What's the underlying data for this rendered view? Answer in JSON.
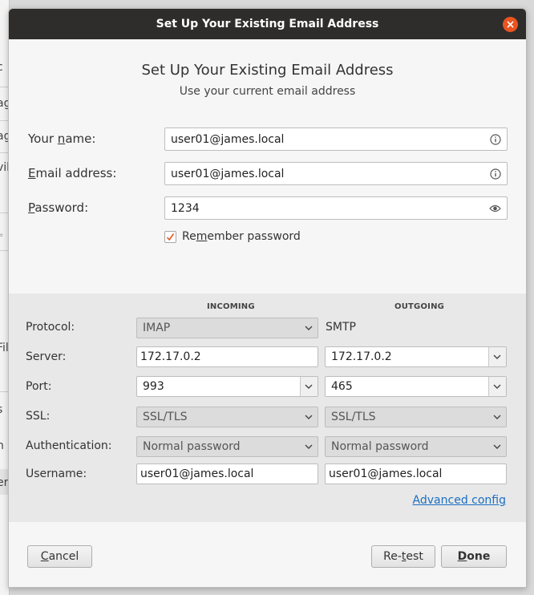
{
  "background_app": {
    "fragments": [
      "c",
      "ag",
      "ag",
      "vil",
      "=",
      "Fil",
      "s",
      "n",
      "er"
    ]
  },
  "window": {
    "title": "Set Up Your Existing Email Address",
    "close_icon": "close-icon"
  },
  "header": {
    "title": "Set Up Your Existing Email Address",
    "subtitle": "Use your current email address"
  },
  "form": {
    "name": {
      "label_pre": "Your ",
      "label_key": "n",
      "label_post": "ame:",
      "value": "user01@james.local",
      "icon": "info-icon"
    },
    "email": {
      "label_pre": "",
      "label_key": "E",
      "label_post": "mail address:",
      "value": "user01@james.local",
      "icon": "info-icon"
    },
    "password": {
      "label_pre": "",
      "label_key": "P",
      "label_post": "assword:",
      "value": "1234",
      "icon": "eye-icon"
    },
    "remember": {
      "label_pre": "Re",
      "label_key": "m",
      "label_post": "ember password",
      "checked": true
    }
  },
  "config": {
    "incoming_header": "INCOMING",
    "outgoing_header": "OUTGOING",
    "labels": {
      "protocol": "Protocol:",
      "server": "Server:",
      "port": "Port:",
      "ssl": "SSL:",
      "authentication": "Authentication:",
      "username": "Username:"
    },
    "incoming": {
      "protocol": "IMAP",
      "server": "172.17.0.2",
      "port": "993",
      "ssl": "SSL/TLS",
      "authentication": "Normal password",
      "username": "user01@james.local"
    },
    "outgoing": {
      "protocol": "SMTP",
      "server": "172.17.0.2",
      "port": "465",
      "ssl": "SSL/TLS",
      "authentication": "Normal password",
      "username": "user01@james.local"
    },
    "advanced_link": "Advanced config"
  },
  "buttons": {
    "cancel": {
      "pre": "",
      "key": "C",
      "post": "ancel"
    },
    "retest": {
      "pre": "Re-",
      "key": "t",
      "post": "est"
    },
    "done": {
      "pre": "",
      "key": "D",
      "post": "one"
    }
  },
  "colors": {
    "accent": "#e95420",
    "link": "#1a6fc2",
    "titlebar": "#2f2d2c"
  }
}
